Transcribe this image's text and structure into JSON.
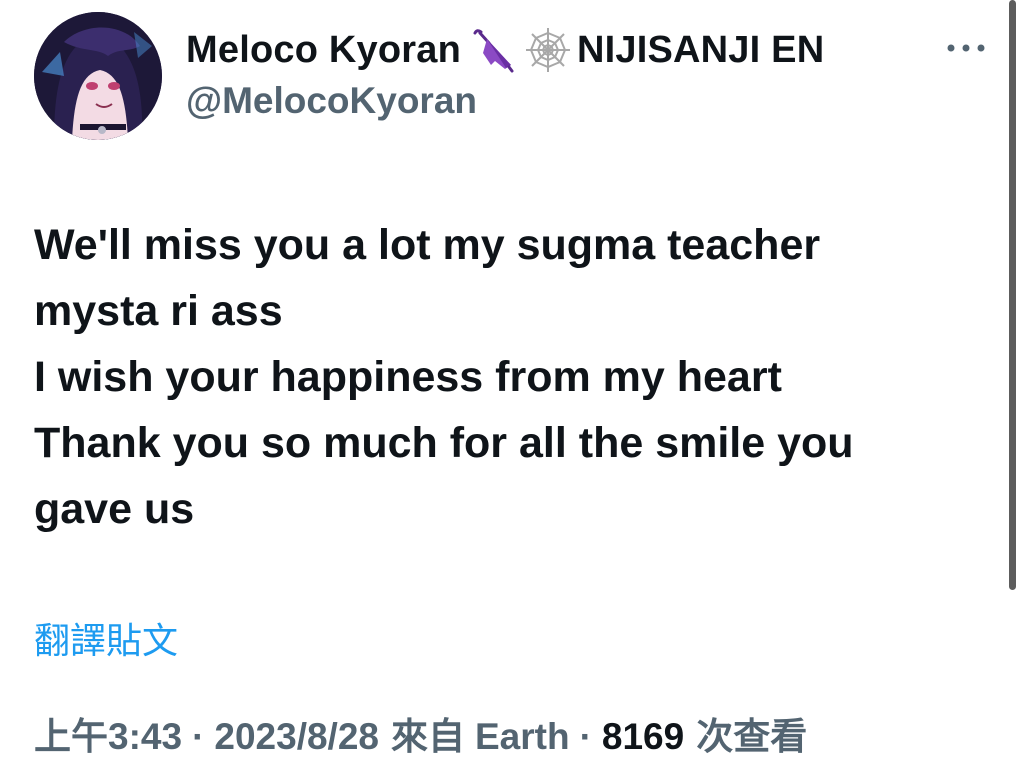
{
  "author": {
    "display_name": "Meloco Kyoran",
    "badge_emojis": [
      "umbrella-icon",
      "spider-web-icon"
    ],
    "affiliation": "NIJISANJI EN",
    "handle": "@MelocoKyoran"
  },
  "tweet": {
    "text": "We'll miss you a lot my sugma teacher\nmysta ri ass\n I wish your happiness from my heart\nThank you so much for all the smile you\ngave us",
    "translate_label": "翻譯貼文"
  },
  "meta": {
    "time": "上午3:43",
    "separator": "·",
    "date": "2023/8/28",
    "source_prefix": "來自",
    "source": "Earth",
    "views_count": "8169",
    "views_label": "次查看"
  },
  "colors": {
    "text_primary": "#0f1419",
    "text_secondary": "#536471",
    "link": "#1d9bf0",
    "umbrella": "#7b3fb8"
  }
}
